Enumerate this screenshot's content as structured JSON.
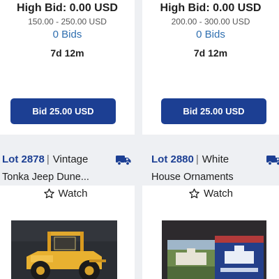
{
  "cards": [
    {
      "high_bid": "High Bid: 0.00 USD",
      "estimate": "150.00 - 250.00 USD",
      "bids": "0 Bids",
      "time_left": "7d 12m",
      "bid_button": "Bid 25.00 USD"
    },
    {
      "high_bid": "High Bid: 0.00 USD",
      "estimate": "200.00 - 300.00 USD",
      "bids": "0 Bids",
      "time_left": "7d 12m",
      "bid_button": "Bid 25.00 USD"
    }
  ],
  "lots": [
    {
      "lot_number": "Lot 2878",
      "separator": "|",
      "title_line1": "Vintage",
      "title_line2": "Tonka Jeep Dune...",
      "watch_label": "Watch",
      "icon": "shipping-truck-icon",
      "image": "yellow-tonka-jeep-photo"
    },
    {
      "lot_number": "Lot 2880",
      "separator": "|",
      "title_line1": "White",
      "title_line2": "House Ornaments",
      "watch_label": "Watch",
      "icon": "shipping-truck-icon",
      "image": "white-house-ornament-boxes-photo"
    }
  ],
  "colors": {
    "accent_blue": "#1c3f93",
    "bids_link": "#2f6fb0",
    "background": "#eef0f3"
  }
}
